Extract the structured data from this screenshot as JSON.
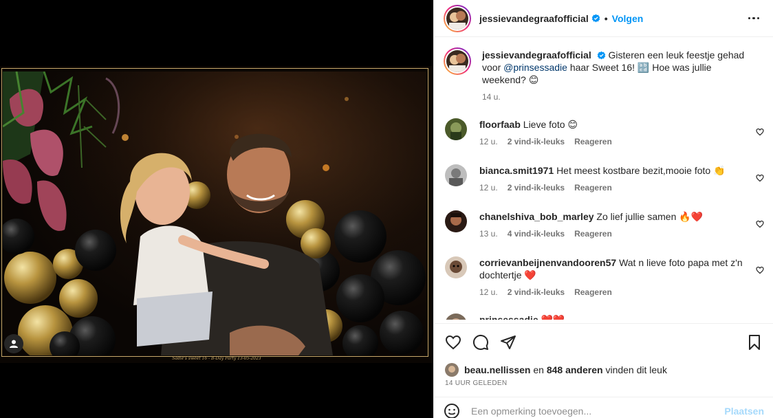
{
  "post": {
    "author": "jessievandegraafofficial",
    "follow_label": "Volgen",
    "separator": "•",
    "photo_caption_strip": "Sadie's sweet 16 - B-Day Party 13-05-2023",
    "caption_text_before": "Gisteren een leuk feestje gehad voor ",
    "caption_mention": "@prinsessadie",
    "caption_text_after": " haar Sweet 16! 🔡 Hoe was jullie weekend? 😊",
    "caption_time": "14 u."
  },
  "comments": [
    {
      "user": "floorfaab",
      "text": "Lieve foto 😊",
      "time": "12 u.",
      "likes": "2 vind-ik-leuks",
      "reply": "Reageren",
      "avatar_color": "#4b5a2a"
    },
    {
      "user": "bianca.smit1971",
      "text": "Het meest kostbare bezit,mooie foto 👏",
      "time": "12 u.",
      "likes": "2 vind-ik-leuks",
      "reply": "Reageren",
      "avatar_color": "#8a8a8a"
    },
    {
      "user": "chanelshiva_bob_marley",
      "text": "Zo lief jullie samen 🔥❤️",
      "time": "13 u.",
      "likes": "4 vind-ik-leuks",
      "reply": "Reageren",
      "avatar_color": "#6b3a2a"
    },
    {
      "user": "corrievanbeijnenvandooren57",
      "text": "Wat n lieve foto papa met z'n dochtertje ❤️",
      "time": "12 u.",
      "likes": "2 vind-ik-leuks",
      "reply": "Reageren",
      "avatar_color": "#5a4536"
    },
    {
      "user": "prinsessadie",
      "text": "❤️❤️",
      "time": "",
      "likes": "",
      "reply": "",
      "avatar_color": "#7a6a5a"
    }
  ],
  "likes": {
    "first_user": "beau.nellissen",
    "joiner": " en ",
    "others": "848 anderen",
    "suffix": " vinden dit leuk"
  },
  "timestamp": "14 UUR GELEDEN",
  "add_comment": {
    "placeholder": "Een opmerking toevoegen...",
    "post_label": "Plaatsen"
  },
  "colors": {
    "accent": "#0095f6",
    "mention": "#00376b",
    "muted": "#737373",
    "frame_gold": "#c8a96b"
  },
  "icons": [
    "user-tag-icon",
    "verified-icon",
    "more-icon",
    "heart-icon",
    "comment-icon",
    "share-icon",
    "bookmark-icon",
    "emoji-icon"
  ]
}
